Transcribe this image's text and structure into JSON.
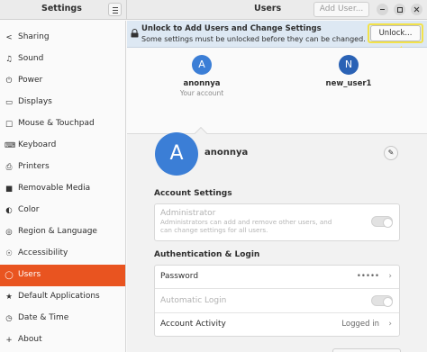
{
  "header": {
    "left_title": "Settings",
    "title": "Users",
    "add_user_label": "Add User..."
  },
  "sidebar": {
    "items": [
      {
        "label": "Sharing",
        "icon": "share-icon"
      },
      {
        "label": "Sound",
        "icon": "music-note-icon"
      },
      {
        "label": "Power",
        "icon": "power-icon"
      },
      {
        "label": "Displays",
        "icon": "display-icon"
      },
      {
        "label": "Mouse & Touchpad",
        "icon": "mouse-icon"
      },
      {
        "label": "Keyboard",
        "icon": "keyboard-icon"
      },
      {
        "label": "Printers",
        "icon": "printer-icon"
      },
      {
        "label": "Removable Media",
        "icon": "removable-media-icon"
      },
      {
        "label": "Color",
        "icon": "color-icon"
      },
      {
        "label": "Region & Language",
        "icon": "globe-icon"
      },
      {
        "label": "Accessibility",
        "icon": "accessibility-icon"
      },
      {
        "label": "Users",
        "icon": "users-icon",
        "active": true
      },
      {
        "label": "Default Applications",
        "icon": "star-icon"
      },
      {
        "label": "Date & Time",
        "icon": "clock-icon"
      },
      {
        "label": "About",
        "icon": "info-icon"
      }
    ]
  },
  "infobar": {
    "title": "Unlock to Add Users and Change Settings",
    "subtitle": "Some settings must be unlocked before they can be changed.",
    "unlock_label": "Unlock..."
  },
  "users": [
    {
      "initial": "A",
      "name": "anonnya",
      "subtitle": "Your account"
    },
    {
      "initial": "N",
      "name": "new_user1",
      "subtitle": ""
    }
  ],
  "profile": {
    "initial": "A",
    "name": "anonnya"
  },
  "account_settings": {
    "heading": "Account Settings",
    "administrator_label": "Administrator",
    "administrator_desc": "Administrators can add and remove other users, and can change settings for all users."
  },
  "auth": {
    "heading": "Authentication & Login",
    "password_label": "Password",
    "password_value": "•••••",
    "autologin_label": "Automatic Login",
    "activity_label": "Account Activity",
    "activity_value": "Logged in"
  },
  "colors": {
    "accent": "#e95420",
    "avatar": "#3b7ed6",
    "highlight": "#f2e24a"
  }
}
